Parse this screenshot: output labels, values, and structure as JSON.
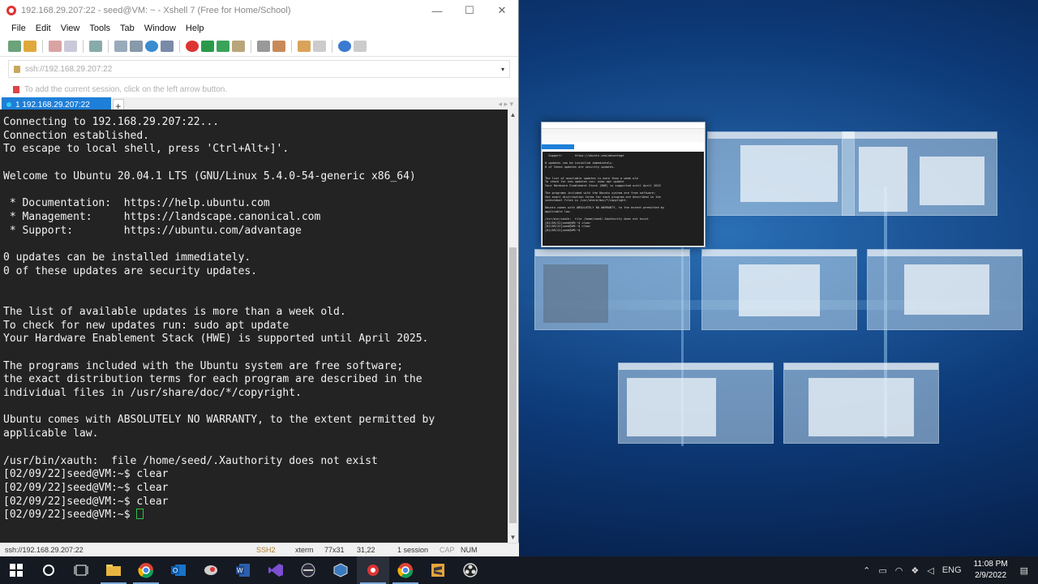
{
  "window": {
    "title": "192.168.29.207:22 - seed@VM: ~ - Xshell 7 (Free for Home/School)",
    "minimize": "—",
    "maximize": "☐",
    "close": "✕"
  },
  "menu": [
    "File",
    "Edit",
    "View",
    "Tools",
    "Tab",
    "Window",
    "Help"
  ],
  "address": {
    "value": "ssh://192.168.29.207:22",
    "dropdown": "▾"
  },
  "hint": "To add the current session, click on the left arrow button.",
  "tab": {
    "label": "1 192.168.29.207:22",
    "add": "+",
    "nav": "◂ ▸ ▾"
  },
  "terminal": {
    "lines": [
      "Connecting to 192.168.29.207:22...",
      "Connection established.",
      "To escape to local shell, press 'Ctrl+Alt+]'.",
      "",
      "Welcome to Ubuntu 20.04.1 LTS (GNU/Linux 5.4.0-54-generic x86_64)",
      "",
      " * Documentation:  https://help.ubuntu.com",
      " * Management:     https://landscape.canonical.com",
      " * Support:        https://ubuntu.com/advantage",
      "",
      "0 updates can be installed immediately.",
      "0 of these updates are security updates.",
      "",
      "",
      "The list of available updates is more than a week old.",
      "To check for new updates run: sudo apt update",
      "Your Hardware Enablement Stack (HWE) is supported until April 2025.",
      "",
      "The programs included with the Ubuntu system are free software;",
      "the exact distribution terms for each program are described in the",
      "individual files in /usr/share/doc/*/copyright.",
      "",
      "Ubuntu comes with ABSOLUTELY NO WARRANTY, to the extent permitted by",
      "applicable law.",
      "",
      "/usr/bin/xauth:  file /home/seed/.Xauthority does not exist",
      "[02/09/22]seed@VM:~$ clear",
      "[02/09/22]seed@VM:~$ clear",
      "[02/09/22]seed@VM:~$ clear"
    ],
    "prompt": "[02/09/22]seed@VM:~$ "
  },
  "status": {
    "address": "ssh://192.168.29.207:22",
    "protocol": "SSH2",
    "term": "xterm",
    "size": "77x31",
    "pos": "31,22",
    "sessions": "1 session",
    "cap": "CAP",
    "num": "NUM"
  },
  "thumbnail_text": "  Support:       https://ubuntu.com/advantage\n\n0 updates can be installed immediately.\n0 of these updates are security updates.\n\n\nThe list of available updates is more than a week old\nTo check for new updates run: sudo apt update\nYour Hardware Enablement Stack (HWE) is supported until April 2025\n\nThe programs included with the Ubuntu system are free software;\nthe exact distribution terms for each program are described in the\nindividual files in /usr/share/doc/*/copyright.\n\nUbuntu comes with ABSOLUTELY NO WARRANTY, to the extent permitted by\napplicable law.\n\n/usr/bin/xauth:  file /home/seed/.Xauthority does not exist\n[02/09/22]seed@VM:~$ clear\n[02/09/22]seed@VM:~$ clear\n[02/09/22]seed@VM:~$ ",
  "taskbar": {
    "lang": "ENG",
    "time": "11:08 PM",
    "date": "2/9/2022",
    "icons": [
      "windows-start-icon",
      "cortana-icon",
      "task-view-icon",
      "file-explorer-icon",
      "chrome-icon",
      "outlook-icon",
      "app-icon",
      "word-icon",
      "visual-studio-icon",
      "terminal-icon",
      "virtualbox-icon",
      "xshell-icon",
      "chrome-icon-2",
      "sublime-icon",
      "obs-icon"
    ]
  },
  "colors": {
    "accent": "#1e7fd8",
    "terminal_bg": "#232323",
    "terminal_fg": "#f2f2f2",
    "cursor": "#31c04a",
    "taskbar": "#151922"
  }
}
